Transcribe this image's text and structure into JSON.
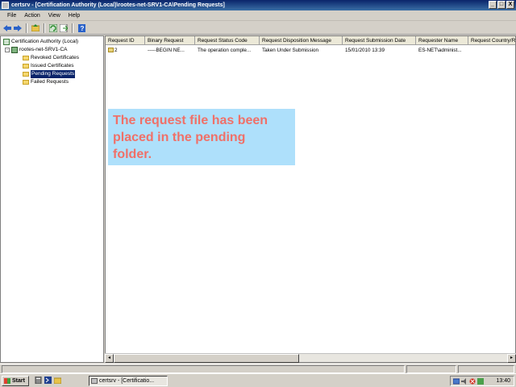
{
  "window": {
    "title": "certsrv - [Certification Authority (Local)\\rootes-net-SRV1-CA\\Pending Requests]",
    "buttons": [
      "_",
      "□",
      "X"
    ]
  },
  "menubar": [
    "File",
    "Action",
    "View",
    "Help"
  ],
  "toolbar": {
    "icons": [
      "back-icon",
      "forward-icon",
      "up-folder-icon",
      "refresh-icon",
      "export-list-icon",
      "help-icon"
    ]
  },
  "tree": {
    "root": "Certification Authority (Local)",
    "ca": "rootes-net-SRV1-CA",
    "folders": [
      "Revoked Certificates",
      "Issued Certificates",
      "Pending Requests",
      "Failed Requests"
    ],
    "selected": "Pending Requests"
  },
  "list": {
    "columns": [
      "Request ID",
      "Binary Request",
      "Request Status Code",
      "Request Disposition Message",
      "Request Submission Date",
      "Requester Name",
      "Request Country/Reg"
    ],
    "rows": [
      [
        "2",
        "-----BEGIN NE...",
        "The operation comple...",
        "Taken Under Submission",
        "15/01/2010 13:39",
        "ES-NET\\administ...",
        ""
      ]
    ]
  },
  "callout": {
    "lines": [
      "The request file has been",
      "placed in the pending",
      "folder."
    ],
    "color": "#f07068",
    "background": "#aee0fb"
  },
  "taskbar": {
    "start": "Start",
    "task": "certsrv - [Certificatio...",
    "clock": "13:40"
  }
}
